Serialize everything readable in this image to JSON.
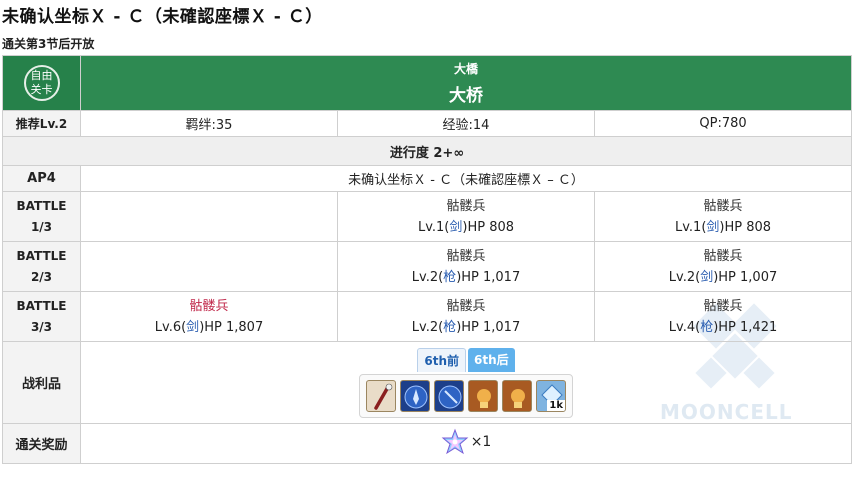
{
  "page": {
    "title": "未确认坐标Ｘ - Ｃ（未確認座標Ｘ - Ｃ）",
    "unlock_note": "通关第3节后开放"
  },
  "header": {
    "badge_line1": "自由",
    "badge_line2": "关卡",
    "jp_name": "大橋",
    "cn_name": "大桥"
  },
  "recommend": {
    "label": "推荐Lv.2",
    "bond": "羁绊:35",
    "exp": "经验:14",
    "qp": "QP:780"
  },
  "progress": {
    "label": "进行度 2+∞"
  },
  "ap": {
    "label": "AP4",
    "location": "未确认坐标Ｘ - Ｃ（未確認座標Ｘ – Ｃ）"
  },
  "battles": [
    {
      "label_top": "BATTLE",
      "label_bottom": "1/3",
      "enemies": [
        null,
        {
          "name": "骷髅兵",
          "lv": "Lv.1(",
          "cls": "剑",
          "hp": ")HP 808"
        },
        {
          "name": "骷髅兵",
          "lv": "Lv.1(",
          "cls": "剑",
          "hp": ")HP 808"
        }
      ]
    },
    {
      "label_top": "BATTLE",
      "label_bottom": "2/3",
      "enemies": [
        null,
        {
          "name": "骷髅兵",
          "lv": "Lv.2(",
          "cls": "枪",
          "hp": ")HP 1,017"
        },
        {
          "name": "骷髅兵",
          "lv": "Lv.2(",
          "cls": "剑",
          "hp": ")HP 1,007"
        }
      ]
    },
    {
      "label_top": "BATTLE",
      "label_bottom": "3/3",
      "enemies": [
        {
          "name": "骷髅兵",
          "lv": "Lv.6(",
          "cls": "剑",
          "hp": ")HP 1,807"
        },
        {
          "name": "骷髅兵",
          "lv": "Lv.2(",
          "cls": "枪",
          "hp": ")HP 1,017"
        },
        {
          "name": "骷髅兵",
          "lv": "Lv.4(",
          "cls": "枪",
          "hp": ")HP 1,421"
        }
      ]
    }
  ],
  "drops": {
    "label": "战利品",
    "tab_before": "6th前",
    "tab_after": "6th后",
    "items": [
      {
        "icon": "bone-item-icon"
      },
      {
        "icon": "blue-gem-icon"
      },
      {
        "icon": "blue-gem-icon"
      },
      {
        "icon": "gold-piece-icon"
      },
      {
        "icon": "gold-piece-icon"
      },
      {
        "icon": "exp-card-icon",
        "qty": "1k"
      }
    ]
  },
  "reward": {
    "label": "通关奖励",
    "amount": "×1",
    "icon": "saint-quartz-icon"
  },
  "watermark": {
    "text": "MOONCELL"
  },
  "colors": {
    "header_green": "#2e8a52",
    "danger_red": "#c0284a",
    "class_blue": "#2a5db0",
    "tab_blue": "#5fb1ec"
  }
}
